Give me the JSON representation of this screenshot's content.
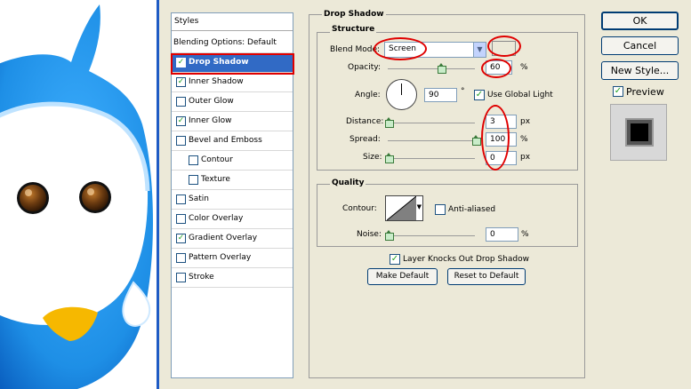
{
  "styles_list": {
    "header": "Styles",
    "items": [
      {
        "label": "Blending Options: Default",
        "checkbox": false,
        "checked": false,
        "indent": 0,
        "selected": false
      },
      {
        "label": "Drop Shadow",
        "checkbox": true,
        "checked": true,
        "indent": 0,
        "selected": true
      },
      {
        "label": "Inner Shadow",
        "checkbox": true,
        "checked": true,
        "indent": 0,
        "selected": false
      },
      {
        "label": "Outer Glow",
        "checkbox": true,
        "checked": false,
        "indent": 0,
        "selected": false
      },
      {
        "label": "Inner Glow",
        "checkbox": true,
        "checked": true,
        "indent": 0,
        "selected": false
      },
      {
        "label": "Bevel and Emboss",
        "checkbox": true,
        "checked": false,
        "indent": 0,
        "selected": false
      },
      {
        "label": "Contour",
        "checkbox": true,
        "checked": false,
        "indent": 1,
        "selected": false
      },
      {
        "label": "Texture",
        "checkbox": true,
        "checked": false,
        "indent": 1,
        "selected": false
      },
      {
        "label": "Satin",
        "checkbox": true,
        "checked": false,
        "indent": 0,
        "selected": false
      },
      {
        "label": "Color Overlay",
        "checkbox": true,
        "checked": false,
        "indent": 0,
        "selected": false
      },
      {
        "label": "Gradient Overlay",
        "checkbox": true,
        "checked": true,
        "indent": 0,
        "selected": false
      },
      {
        "label": "Pattern Overlay",
        "checkbox": true,
        "checked": false,
        "indent": 0,
        "selected": false
      },
      {
        "label": "Stroke",
        "checkbox": true,
        "checked": false,
        "indent": 0,
        "selected": false
      }
    ]
  },
  "drop_shadow": {
    "title": "Drop Shadow",
    "structure": {
      "title": "Structure",
      "blend_mode_label": "Blend Mode:",
      "blend_mode_value": "Screen",
      "shadow_color": "#ffffff",
      "opacity_label": "Opacity:",
      "opacity_value": "60",
      "opacity_unit": "%",
      "opacity_level": 0.6,
      "angle_label": "Angle:",
      "angle_value": "90",
      "angle_unit": "°",
      "use_global_light_label": "Use Global Light",
      "use_global_light_checked": true,
      "distance_label": "Distance:",
      "distance_value": "3",
      "distance_unit": "px",
      "distance_level": 0.0,
      "spread_label": "Spread:",
      "spread_value": "100",
      "spread_unit": "%",
      "spread_level": 1.0,
      "size_label": "Size:",
      "size_value": "0",
      "size_unit": "px",
      "size_level": 0.0
    },
    "quality": {
      "title": "Quality",
      "contour_label": "Contour:",
      "anti_aliased_label": "Anti-aliased",
      "anti_aliased_checked": false,
      "noise_label": "Noise:",
      "noise_value": "0",
      "noise_unit": "%",
      "noise_level": 0.0
    },
    "knockout_label": "Layer Knocks Out Drop Shadow",
    "knockout_checked": true,
    "make_default_label": "Make Default",
    "reset_default_label": "Reset to Default"
  },
  "buttons": {
    "ok": "OK",
    "cancel": "Cancel",
    "new_style": "New Style...",
    "preview_label": "Preview",
    "preview_checked": true
  },
  "colors": {
    "selection": "#316ac5",
    "annotation": "#e00000",
    "bird_blue": "#1e8fe6"
  }
}
